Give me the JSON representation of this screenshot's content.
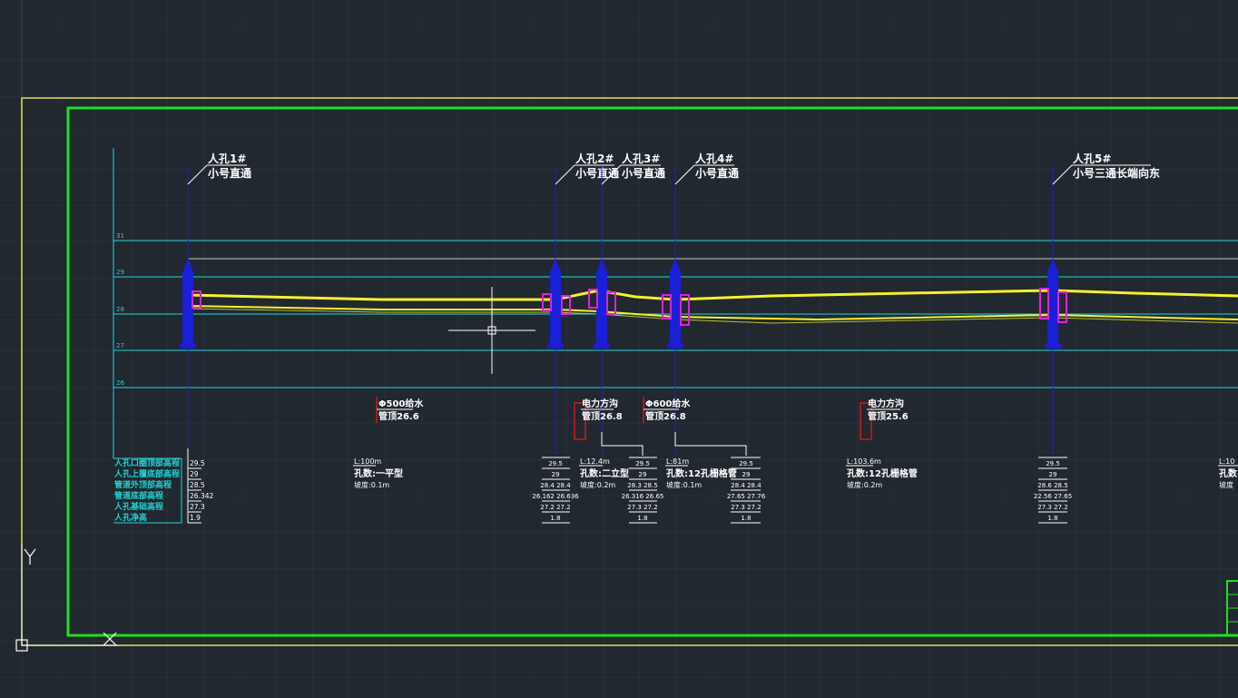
{
  "colors": {
    "background": "#212830",
    "grid": "#2e3641",
    "outer_border": "#e6e24a",
    "inner_border": "#1ee01e",
    "grid_line": "#22d3d3",
    "reference_line": "#c8c8c8",
    "manhole": "#1a1fd8",
    "pipe": "#f5f22a",
    "marker": "#e020e0",
    "label": "#ffffff",
    "table_label": "#22d3d3",
    "crossing": "#d01818"
  },
  "scale_labels": [
    "31",
    "29",
    "28",
    "27",
    "26"
  ],
  "manholes": [
    {
      "title": "人孔1#",
      "type": "小号直通"
    },
    {
      "title": "人孔2#",
      "type": "小号直通"
    },
    {
      "title": "人孔3#",
      "type": "小号直通"
    },
    {
      "title": "人孔4#",
      "type": "小号直通"
    },
    {
      "title": "人孔5#",
      "type": "小号三通长端向东"
    }
  ],
  "crossings": [
    {
      "name": "Φ500给水",
      "elev": "管顶26.6"
    },
    {
      "name": "电力方沟",
      "elev": "管顶26.8"
    },
    {
      "name": "Φ600给水",
      "elev": "管顶26.8"
    },
    {
      "name": "电力方沟",
      "elev": "管顶25.6"
    }
  ],
  "table_labels": [
    "人孔口圈顶部高程",
    "人孔上覆底部高程",
    "管道外顶部高程",
    "管道底部高程",
    "人孔基础高程",
    "人孔净高"
  ],
  "station_values": [
    [
      "29.5",
      "29",
      "28.5",
      "26.342",
      "27.3",
      "1.9"
    ],
    [
      "29.5",
      "29",
      "28.4  28.4",
      "26.162  26.636",
      "27.2  27.2",
      "1.8"
    ],
    [
      "29.5",
      "29",
      "28.3  28.5",
      "26.316  26.65",
      "27.3  27.2",
      "1.8"
    ],
    [
      "29.5",
      "29",
      "28.4  28.4",
      "27.65  27.76",
      "27.3  27.2",
      "1.8"
    ],
    [
      "29.5",
      "29",
      "28.6  28.5",
      "22.56  27.65",
      "27.3  27.2",
      "1.8"
    ]
  ],
  "segments": [
    {
      "length": "L:100m",
      "hole": "孔数:一平型",
      "slope": "坡度:0.1m"
    },
    {
      "length": "L:12.4m",
      "hole": "孔数:二立型",
      "slope": "坡度:0.2m"
    },
    {
      "length": "L:81m",
      "hole": "孔数:12孔栅格管",
      "slope": "坡度:0.1m"
    },
    {
      "length": "L:103.6m",
      "hole": "孔数:12孔栅格管",
      "slope": "坡度:0.2m"
    },
    {
      "length": "L:10",
      "hole": "孔数",
      "slope": "坡度"
    }
  ]
}
